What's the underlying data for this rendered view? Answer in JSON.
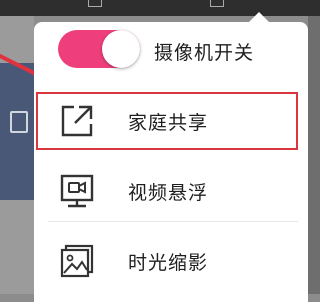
{
  "menu": {
    "camera_switch": {
      "label": "摄像机开关",
      "state": "on",
      "color": "#ee3f7c"
    },
    "items": [
      {
        "label": "家庭共享",
        "icon": "share-icon",
        "highlighted": true
      },
      {
        "label": "视频悬浮",
        "icon": "video-float-icon",
        "highlighted": false
      },
      {
        "label": "时光缩影",
        "icon": "timelapse-icon",
        "highlighted": false
      }
    ]
  },
  "highlight_color": "#d9363e"
}
